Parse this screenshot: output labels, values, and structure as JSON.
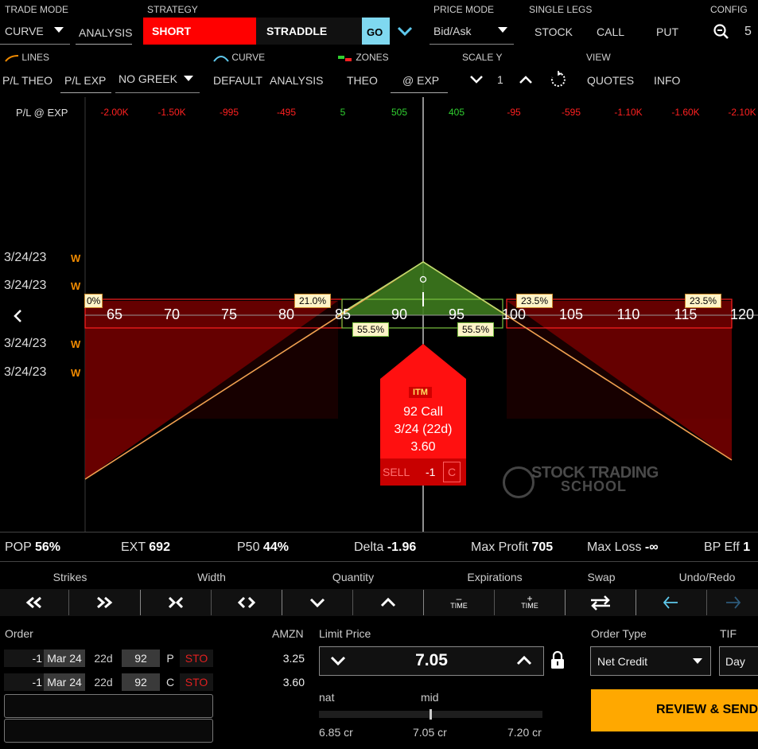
{
  "top": {
    "trade_mode": {
      "header": "TRADE MODE",
      "value": "CURVE"
    },
    "analysis_tab": "ANALYSIS",
    "strategy": {
      "header": "STRATEGY",
      "direction": "SHORT",
      "type": "STRADDLE",
      "go": "GO"
    },
    "price_mode": {
      "header": "PRICE MODE",
      "value": "Bid/Ask"
    },
    "single_legs": {
      "header": "SINGLE LEGS",
      "stock": "STOCK",
      "call": "CALL",
      "put": "PUT"
    },
    "config": {
      "header": "CONFIG",
      "zoom_value": "5"
    }
  },
  "second": {
    "lines": {
      "header": "LINES",
      "opt1": "P/L THEO",
      "opt2": "P/L EXP",
      "greek": "NO GREEK"
    },
    "curve": {
      "header": "CURVE",
      "opt1": "DEFAULT",
      "opt2": "ANALYSIS"
    },
    "zones": {
      "header": "ZONES",
      "opt1": "THEO",
      "opt2": "@ EXP"
    },
    "scale_y": {
      "header": "SCALE Y",
      "value": "1"
    },
    "view": {
      "header": "VIEW",
      "opt1": "QUOTES",
      "opt2": "INFO"
    }
  },
  "chart": {
    "pl_label": "P/L @ EXP",
    "pl_values": [
      "-2.00K",
      "-1.50K",
      "-995",
      "-495",
      "5",
      "505",
      "405",
      "-95",
      "-595",
      "-1.10K",
      "-1.60K",
      "-2.10K"
    ],
    "pl_colors": [
      "#ff2020",
      "#ff2020",
      "#ff2020",
      "#ff2020",
      "#30d030",
      "#30d030",
      "#30d030",
      "#ff2020",
      "#ff2020",
      "#ff2020",
      "#ff2020",
      "#ff2020"
    ],
    "dates": [
      "3/24/23",
      "3/24/23",
      "3/24/23",
      "3/24/23"
    ],
    "w_badge": "W",
    "strikes": [
      "65",
      "70",
      "75",
      "80",
      "85",
      "90",
      "95",
      "100",
      "105",
      "110",
      "115",
      "120"
    ],
    "prob_labels": {
      "far_left": "0%",
      "left": "21.0%",
      "inner_left": "55.5%",
      "inner_right": "55.5%",
      "right": "23.5%",
      "far_right": "23.5%"
    },
    "tooltip": {
      "badge": "ITM",
      "name": "92 Call",
      "expiry": "3/24 (22d)",
      "price": "3.60",
      "action": "SELL",
      "qty": "-1",
      "type": "C"
    },
    "watermark_line1": "STOCK TRADING",
    "watermark_line2": "SCHOOL"
  },
  "stats": {
    "pop": {
      "label": "POP",
      "value": "56%"
    },
    "ext": {
      "label": "EXT",
      "value": "692"
    },
    "p50": {
      "label": "P50",
      "value": "44%"
    },
    "delta": {
      "label": "Delta",
      "value": "-1.96"
    },
    "max_profit": {
      "label": "Max Profit",
      "value": "705"
    },
    "max_loss": {
      "label": "Max Loss",
      "value": "-∞"
    },
    "bp": {
      "label": "BP Eff",
      "value": "1"
    }
  },
  "toolbar": {
    "strikes": "Strikes",
    "width": "Width",
    "quantity": "Quantity",
    "expirations": "Expirations",
    "swap": "Swap",
    "undo_redo": "Undo/Redo",
    "time": "TIME"
  },
  "order": {
    "header": "Order",
    "symbol": "AMZN",
    "legs": [
      {
        "qty": "-1",
        "exp": "Mar 24",
        "dte": "22d",
        "strike": "92",
        "type": "P",
        "action": "STO",
        "price": "3.25"
      },
      {
        "qty": "-1",
        "exp": "Mar 24",
        "dte": "22d",
        "strike": "92",
        "type": "C",
        "action": "STO",
        "price": "3.60"
      }
    ],
    "limit_price": {
      "header": "Limit Price",
      "value": "7.05"
    },
    "nat_label": "nat",
    "mid_label": "mid",
    "nat_price": "6.85 cr",
    "mid_price": "7.05 cr",
    "far_price": "7.20 cr",
    "order_type": {
      "header": "Order Type",
      "value": "Net Credit"
    },
    "tif": {
      "header": "TIF",
      "value": "Day"
    },
    "review_button": "REVIEW & SEND"
  }
}
